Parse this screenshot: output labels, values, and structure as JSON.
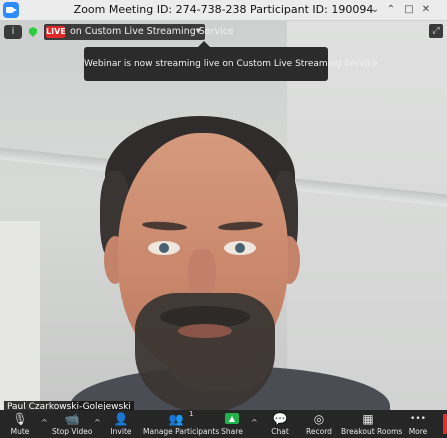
{
  "window": {
    "title": "Zoom Meeting ID: 274-738-238 Participant ID: 190094",
    "controls": [
      "minimize-icon",
      "restore-icon",
      "maximize-icon",
      "close-icon"
    ],
    "control_glyphs": [
      "⌄",
      "⌃",
      "□",
      "✕"
    ]
  },
  "top_bar": {
    "info_icon": "i",
    "live_badge": "LIVE",
    "live_text": "on Custom Live Streaming Service",
    "live_chevron": "▼",
    "fullscreen_icon": "⤢"
  },
  "toast": {
    "text": "Webinar is now streaming live on Custom Live Streaming Service"
  },
  "participant": {
    "name": "Paul Czarkowski-Golejewski"
  },
  "toolbar": {
    "mute": {
      "label": "Mute",
      "icon": "🎙"
    },
    "stop_video": {
      "label": "Stop Video",
      "icon": "📹"
    },
    "invite": {
      "label": "Invite",
      "icon": "👤"
    },
    "manage": {
      "label": "Manage Participants",
      "icon": "👥",
      "count": "1"
    },
    "share": {
      "label": "Share",
      "icon": "▲"
    },
    "chat": {
      "label": "Chat",
      "icon": "💬"
    },
    "record": {
      "label": "Record",
      "icon": "◎"
    },
    "breakout": {
      "label": "Breakout Rooms",
      "icon": "▦"
    },
    "more": {
      "label": "More",
      "icon": "•••"
    },
    "caret": "^"
  },
  "colors": {
    "live": "#e02828",
    "share": "#22b24c",
    "app_icon": "#2d8cff",
    "security": "#2ecc40"
  }
}
